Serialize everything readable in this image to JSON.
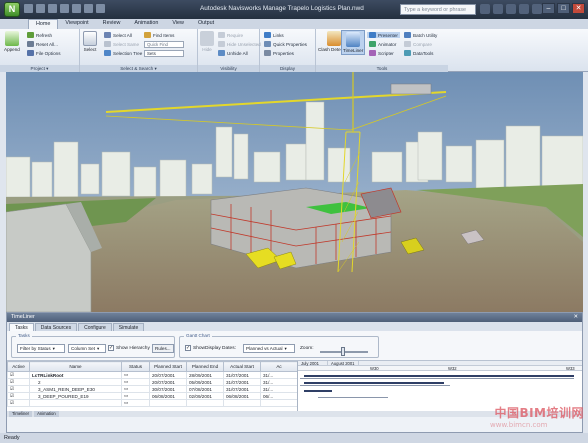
{
  "window": {
    "title": "Autodesk Navisworks Manage   Trapelo Logistics Plan.nwd",
    "search_placeholder": "Type a keyword or phrase"
  },
  "ribbon_tabs": [
    "Home",
    "Viewpoint",
    "Review",
    "Animation",
    "View",
    "Output"
  ],
  "ribbon": {
    "project": {
      "label": "Project ▾",
      "append": "Append",
      "refresh": "Refresh",
      "reset_all": "Reset All...",
      "file_options": "File Options"
    },
    "select_search": {
      "label": "Select & Search ▾",
      "select": "Select",
      "select_all": "Select All",
      "select_same": "Select Same",
      "selection_tree": "Selection Tree",
      "find_items": "Find Items",
      "quick_find": "Quick Find",
      "sets_dropdown": "Sets"
    },
    "visibility": {
      "label": "Visibility",
      "hide": "Hide",
      "require": "Require",
      "hide_unselected": "Hide Unselected",
      "unhide_all": "Unhide All"
    },
    "display": {
      "label": "Display",
      "links": "Links",
      "quick_properties": "Quick Properties",
      "properties": "Properties"
    },
    "tools": {
      "label": "Tools",
      "clash_detective": "Clash Detective",
      "timeliner": "TimeLiner",
      "presenter": "Presenter",
      "animator": "Animator",
      "scripter": "Scripter",
      "batch_utility": "Batch Utility",
      "compare": "Compare",
      "datatools": "DataTools"
    }
  },
  "timeliner": {
    "title": "TimeLiner",
    "tabs": [
      "Tasks",
      "Data Sources",
      "Configure",
      "Simulate"
    ],
    "tasks_group": "Tasks",
    "filter": "Filter by Status",
    "column_set": "Column Set",
    "show_hierarchy": "Show Hierarchy",
    "rules": "Rules...",
    "gantt_group": "Gantt Chart",
    "show": "Show",
    "display_dates_label": "Display Dates:",
    "display_dates": "Planned vs Actual",
    "zoom_label": "Zoom:",
    "columns": [
      "Active",
      "Name",
      "Status",
      "Planned Start",
      "Planned End",
      "Actual Start",
      "Ac"
    ],
    "rows": [
      {
        "name": "LcTRLinkRoot",
        "planned_start": "20/07/2001",
        "planned_end": "28/09/2001",
        "actual_start": "31/07/2001",
        "actual_end": "31/..."
      },
      {
        "name": "2",
        "planned_start": "20/07/2001",
        "planned_end": "05/09/2001",
        "actual_start": "31/07/2001",
        "actual_end": "31/..."
      },
      {
        "name": "3_ASM1_REIN_DEEP_E30",
        "planned_start": "30/07/2001",
        "planned_end": "07/08/2001",
        "actual_start": "31/07/2001",
        "actual_end": "31/..."
      },
      {
        "name": "3_DEEP_POURED_E19",
        "planned_start": "06/08/2001",
        "planned_end": "02/09/2001",
        "actual_start": "06/08/2001",
        "actual_end": "06/..."
      },
      {
        "name": "",
        "planned_start": "",
        "planned_end": "",
        "actual_start": "",
        "actual_end": ""
      }
    ],
    "gantt_months": [
      "July 2001",
      "August 2001"
    ],
    "gantt_weeks": [
      "W30",
      "W32",
      "W33"
    ],
    "bottom_tabs": [
      "Timeliner",
      "Animation"
    ]
  },
  "status": "Ready",
  "watermark": "中国BIM培训网",
  "watermark_url": "www.bimcn.com"
}
